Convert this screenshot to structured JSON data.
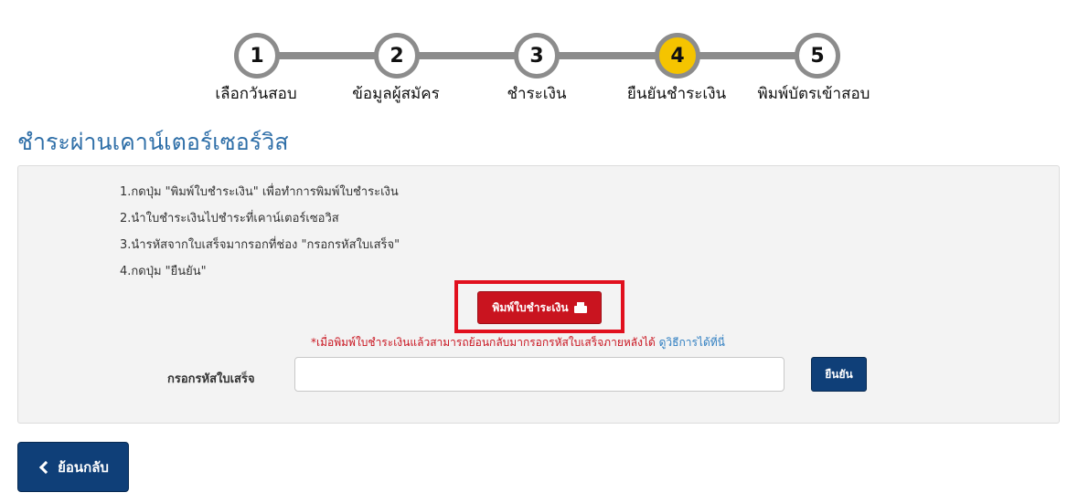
{
  "stepper": {
    "steps": [
      {
        "number": "1",
        "label": "เลือกวันสอบ"
      },
      {
        "number": "2",
        "label": "ข้อมูลผู้สมัคร"
      },
      {
        "number": "3",
        "label": "ชำระเงิน"
      },
      {
        "number": "4",
        "label": "ยืนยันชำระเงิน"
      },
      {
        "number": "5",
        "label": "พิมพ์บัตรเข้าสอบ"
      }
    ],
    "active_step": 4,
    "active_color": "#f5c400"
  },
  "page": {
    "title": "ชำระผ่านเคาน์เตอร์เซอร์วิส"
  },
  "instructions": [
    "1.กดปุ่ม \"พิมพ์ใบชำระเงิน\" เพื่อทำการพิมพ์ใบชำระเงิน",
    "2.นำใบชำระเงินไปชำระที่เคาน์เตอร์เซอวิส",
    "3.นำรหัสจากใบเสร็จมากรอกที่ช่อง \"กรอกรหัสใบเสร็จ\"",
    "4.กดปุ่ม \"ยืนยัน\""
  ],
  "print_button": {
    "label": "พิมพ์ใบชำระเงิน",
    "icon": "printer-icon"
  },
  "note": {
    "text": "*เมื่อพิมพ์ใบชำระเงินแล้วสามารถย้อนกลับมากรอกรหัสใบเสร็จภายหลังได้ ",
    "link": "ดูวิธีการได้ที่นี่"
  },
  "receipt": {
    "label": "กรอกรหัสใบเสร็จ",
    "value": "",
    "placeholder": ""
  },
  "confirm_button": {
    "label": "ยืนยัน"
  },
  "back_button": {
    "label": "ย้อนกลับ",
    "icon": "chevron-left-icon"
  },
  "colors": {
    "title": "#2f6fa8",
    "print_button": "#c9141f",
    "primary_button": "#0f3f78",
    "highlight": "#e1101e"
  }
}
